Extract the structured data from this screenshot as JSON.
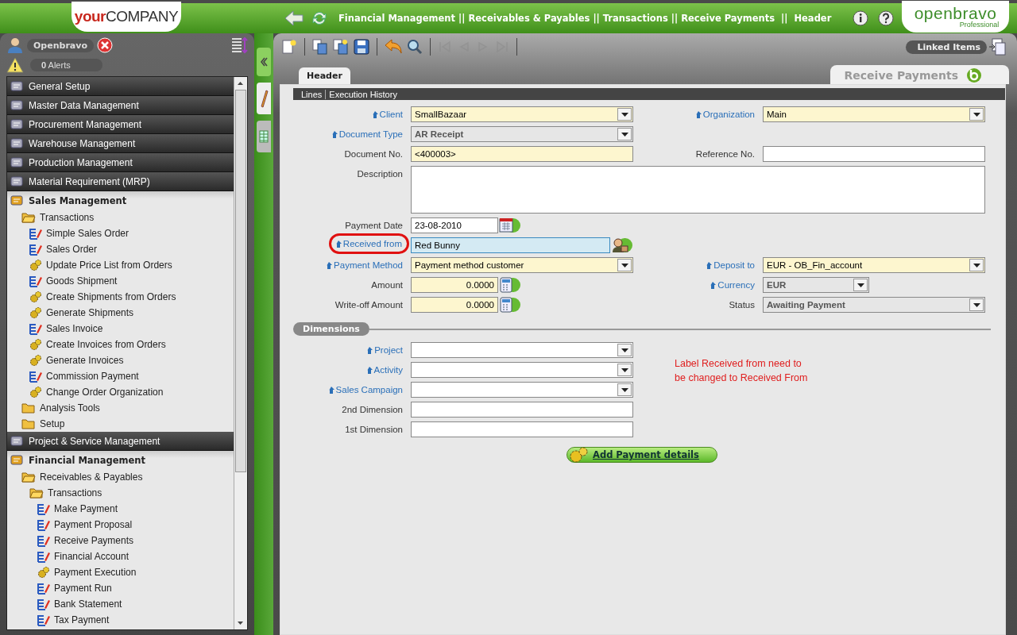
{
  "top_bar": {
    "company_logo": {
      "accent": "your",
      "rest": "COMPANY"
    },
    "breadcrumb": "Financial Management || Receivables & Payables || Transactions || Receive Payments  ||  Header",
    "brand_logo": {
      "name": "openbravo",
      "edition": "Professional"
    }
  },
  "sidebar": {
    "user": "Openbravo",
    "alerts_count": "0",
    "alerts_label": "Alerts",
    "menu": [
      {
        "label": "General Setup",
        "kind": "module",
        "expanded": false
      },
      {
        "label": "Master Data Management",
        "kind": "module",
        "expanded": false
      },
      {
        "label": "Procurement Management",
        "kind": "module",
        "expanded": false
      },
      {
        "label": "Warehouse Management",
        "kind": "module",
        "expanded": false
      },
      {
        "label": "Production Management",
        "kind": "module",
        "expanded": false
      },
      {
        "label": "Material Requirement (MRP)",
        "kind": "module",
        "expanded": false
      },
      {
        "label": "Sales Management",
        "kind": "module",
        "expanded": true,
        "children": [
          {
            "label": "Transactions",
            "kind": "folder",
            "expanded": true,
            "children": [
              {
                "label": "Simple Sales Order",
                "kind": "window"
              },
              {
                "label": "Sales Order",
                "kind": "window"
              },
              {
                "label": "Update Price List from Orders",
                "kind": "process"
              },
              {
                "label": "Goods Shipment",
                "kind": "window"
              },
              {
                "label": "Create Shipments from Orders",
                "kind": "process"
              },
              {
                "label": "Generate Shipments",
                "kind": "process"
              },
              {
                "label": "Sales Invoice",
                "kind": "window"
              },
              {
                "label": "Create Invoices from Orders",
                "kind": "process"
              },
              {
                "label": "Generate Invoices",
                "kind": "process"
              },
              {
                "label": "Commission Payment",
                "kind": "window"
              },
              {
                "label": "Change Order Organization",
                "kind": "process"
              }
            ]
          },
          {
            "label": "Analysis Tools",
            "kind": "folder",
            "expanded": false
          },
          {
            "label": "Setup",
            "kind": "folder",
            "expanded": false
          }
        ]
      },
      {
        "label": "Project & Service Management",
        "kind": "module",
        "expanded": false
      },
      {
        "label": "Financial Management",
        "kind": "module",
        "expanded": true,
        "children": [
          {
            "label": "Receivables & Payables",
            "kind": "folder",
            "expanded": true,
            "children": [
              {
                "label": "Transactions",
                "kind": "folder",
                "expanded": true,
                "children": [
                  {
                    "label": "Make Payment",
                    "kind": "window"
                  },
                  {
                    "label": "Payment Proposal",
                    "kind": "window"
                  },
                  {
                    "label": "Receive Payments",
                    "kind": "window"
                  },
                  {
                    "label": "Financial Account",
                    "kind": "window"
                  },
                  {
                    "label": "Payment Execution",
                    "kind": "process"
                  },
                  {
                    "label": "Payment Run",
                    "kind": "window"
                  },
                  {
                    "label": "Bank Statement",
                    "kind": "window"
                  },
                  {
                    "label": "Tax Payment",
                    "kind": "window"
                  }
                ]
              }
            ]
          }
        ]
      }
    ]
  },
  "toolbar": [
    {
      "kind": "new",
      "disabled": false
    },
    {
      "kind": "copy",
      "disabled": false
    },
    {
      "kind": "copy-new",
      "disabled": false
    },
    {
      "kind": "save",
      "disabled": false
    },
    {
      "kind": "undo",
      "disabled": false
    },
    {
      "kind": "search",
      "disabled": false
    },
    {
      "kind": "first",
      "disabled": true
    },
    {
      "kind": "previous",
      "disabled": true
    },
    {
      "kind": "next",
      "disabled": true
    },
    {
      "kind": "last",
      "disabled": true
    }
  ],
  "linked_items": "Linked Items",
  "tabs": [
    {
      "label": "Header",
      "selected": true
    }
  ],
  "window_title": "Receive Payments",
  "subtabs": [
    "Lines",
    "Execution History"
  ],
  "form": {
    "rows": [
      {
        "left": {
          "label": "Client",
          "kind": "combo",
          "value": "SmallBazaar",
          "link": true,
          "required": true,
          "readonly": false,
          "focused": false,
          "flagged": false
        },
        "right": {
          "label": "Organization",
          "kind": "combo",
          "value": "Main",
          "link": true,
          "required": true,
          "readonly": false,
          "focused": false,
          "flagged": false
        }
      },
      {
        "left": {
          "label": "Document Type",
          "kind": "combo",
          "value": "AR Receipt",
          "link": true,
          "required": false,
          "readonly": true,
          "focused": false,
          "flagged": false
        }
      },
      {
        "left": {
          "label": "Document No.",
          "kind": "text",
          "value": "<400003>",
          "link": false,
          "required": true,
          "readonly": false,
          "focused": false,
          "flagged": false
        },
        "right": {
          "label": "Reference No.",
          "kind": "text",
          "link": false,
          "required": false,
          "readonly": false,
          "focused": false,
          "flagged": false
        }
      },
      {
        "left": {
          "label": "Description",
          "kind": "textarea",
          "link": false,
          "required": false,
          "readonly": false,
          "focused": false,
          "flagged": false
        }
      },
      {
        "left": {
          "label": "Payment Date",
          "kind": "date",
          "value": "23-08-2010",
          "link": false,
          "required": false,
          "readonly": false,
          "focused": false,
          "flagged": false
        }
      },
      {
        "left": {
          "label": "Received from",
          "kind": "search",
          "value": "Red Bunny",
          "link": true,
          "required": true,
          "readonly": false,
          "focused": true,
          "flagged": true
        }
      },
      {
        "left": {
          "label": "Payment Method",
          "kind": "combo",
          "value": "Payment method customer",
          "link": true,
          "required": true,
          "readonly": false,
          "focused": false,
          "flagged": false
        },
        "right": {
          "label": "Deposit to",
          "kind": "combo",
          "value": "EUR - OB_Fin_account",
          "link": true,
          "required": true,
          "readonly": false,
          "focused": false,
          "flagged": false
        }
      },
      {
        "left": {
          "label": "Amount",
          "kind": "number",
          "value": "0.0000",
          "link": false,
          "required": true,
          "readonly": false,
          "focused": false,
          "flagged": false
        },
        "right": {
          "label": "Currency",
          "kind": "small-combo",
          "value": "EUR",
          "link": true,
          "required": false,
          "readonly": true,
          "focused": false,
          "flagged": false
        }
      },
      {
        "left": {
          "label": "Write-off Amount",
          "kind": "number",
          "value": "0.0000",
          "link": false,
          "required": true,
          "readonly": false,
          "focused": false,
          "flagged": false
        },
        "right": {
          "label": "Status",
          "kind": "combo",
          "value": "Awaiting Payment",
          "link": false,
          "required": false,
          "readonly": true,
          "focused": false,
          "flagged": false
        }
      }
    ]
  },
  "dimensions": {
    "title": "Dimensions",
    "fields": [
      {
        "label": "Project",
        "kind": "combo",
        "link": true,
        "required": false,
        "readonly": false,
        "focused": false,
        "flagged": false
      },
      {
        "label": "Activity",
        "kind": "combo",
        "link": true,
        "required": false,
        "readonly": false,
        "focused": false,
        "flagged": false
      },
      {
        "label": "Sales Campaign",
        "kind": "combo",
        "link": true,
        "required": false,
        "readonly": false,
        "focused": false,
        "flagged": false
      },
      {
        "label": "2nd Dimension",
        "kind": "text",
        "link": false,
        "required": false,
        "readonly": false,
        "focused": false,
        "flagged": false
      },
      {
        "label": "1st Dimension",
        "kind": "text",
        "link": false,
        "required": false,
        "readonly": false,
        "focused": false,
        "flagged": false
      }
    ],
    "note": "Label Received from need to be changed to Received From"
  },
  "action_button": "Add Payment details"
}
